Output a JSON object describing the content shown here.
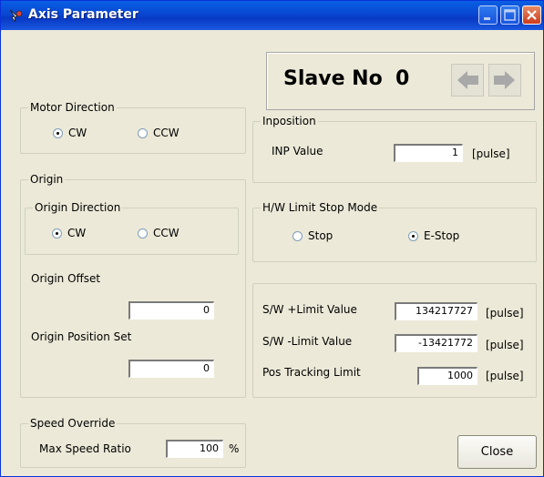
{
  "window": {
    "title": "Axis Parameter"
  },
  "slave": {
    "label": "Slave No",
    "number": "0"
  },
  "motor_direction": {
    "legend": "Motor Direction",
    "cw": "CW",
    "ccw": "CCW",
    "selected": "CW"
  },
  "origin": {
    "legend": "Origin",
    "direction": {
      "legend": "Origin Direction",
      "cw": "CW",
      "ccw": "CCW",
      "selected": "CW"
    },
    "offset_label": "Origin Offset",
    "offset_value": "0",
    "position_set_label": "Origin Position Set",
    "position_set_value": "0"
  },
  "speed_override": {
    "legend": "Speed Override",
    "ratio_label": "Max Speed Ratio",
    "ratio_value": "100",
    "unit": "%"
  },
  "inposition": {
    "legend": "Inposition",
    "inp_label": "INP Value",
    "inp_value": "1",
    "unit": "[pulse]"
  },
  "hw_limit": {
    "legend": "H/W Limit Stop Mode",
    "stop": "Stop",
    "estop": "E-Stop",
    "selected": "E-Stop"
  },
  "sw_limit": {
    "plus_label": "S/W +Limit Value",
    "plus_value": "134217727",
    "minus_label": "S/W -Limit Value",
    "minus_value": "-13421772",
    "tracking_label": "Pos Tracking Limit",
    "tracking_value": "1000",
    "unit": "[pulse]"
  },
  "buttons": {
    "close": "Close"
  },
  "colors": {
    "titlebar": "#0a5fe4",
    "arrow": "#a8a8a8",
    "face": "#ece9d8"
  }
}
